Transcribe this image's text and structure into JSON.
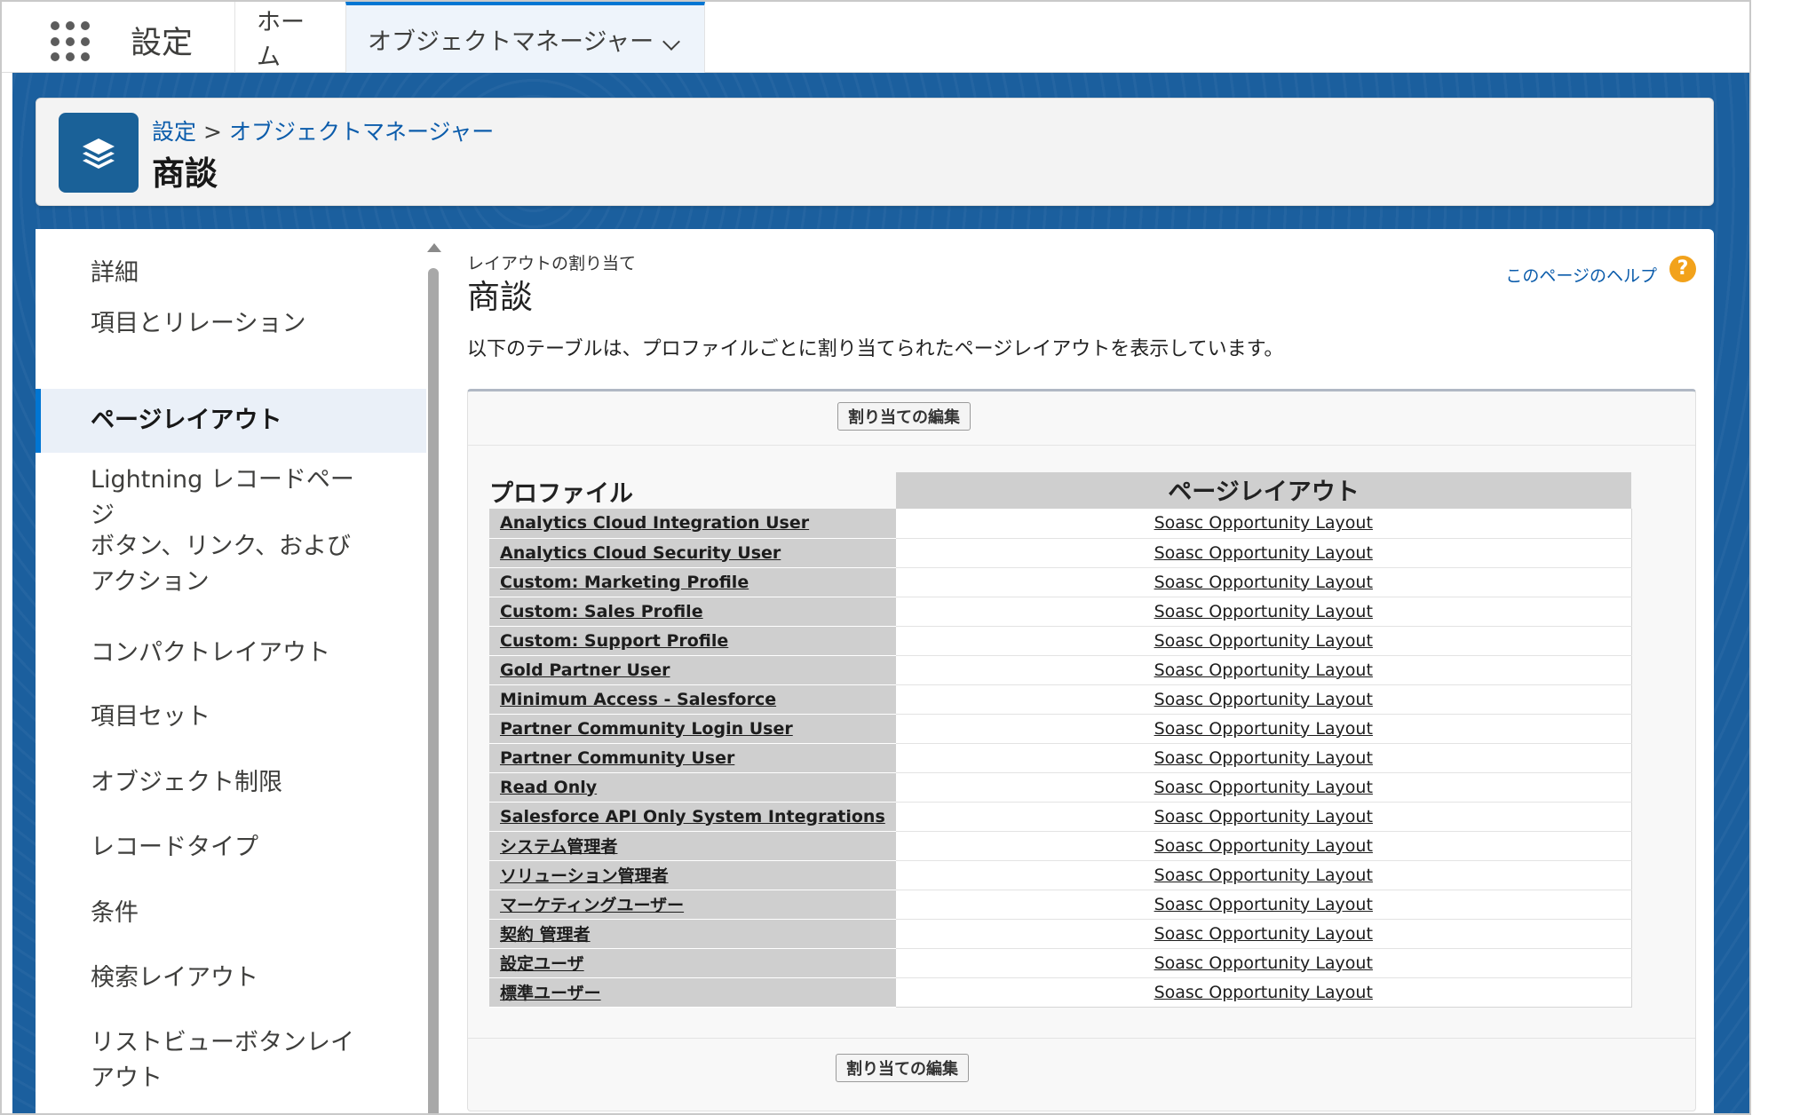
{
  "global_nav": {
    "app_name": "設定",
    "tabs": [
      {
        "label": "ホーム"
      },
      {
        "label": "オブジェクトマネージャー"
      }
    ]
  },
  "header": {
    "breadcrumb": [
      {
        "label": "設定"
      },
      {
        "label": "オブジェクトマネージャー"
      }
    ],
    "breadcrumb_separator": ">",
    "title": "商談",
    "icon": "layers-icon"
  },
  "sidebar": {
    "items": [
      {
        "label": "詳細"
      },
      {
        "label": "項目とリレーション"
      },
      {
        "label": "ページレイアウト",
        "active": true
      },
      {
        "label": "Lightning レコードページ"
      },
      {
        "label": "ボタン、リンク、およびアクション"
      },
      {
        "label": "コンパクトレイアウト"
      },
      {
        "label": "項目セット"
      },
      {
        "label": "オブジェクト制限"
      },
      {
        "label": "レコードタイプ"
      },
      {
        "label": "条件"
      },
      {
        "label": "検索レイアウト"
      },
      {
        "label": "リストビューボタンレイアウト"
      }
    ]
  },
  "main": {
    "subtitle": "レイアウトの割り当て",
    "title": "商談",
    "help_link": "このページのヘルプ",
    "help_icon": "?",
    "description": "以下のテーブルは、プロファイルごとに割り当てられたページレイアウトを表示しています。",
    "edit_button": "割り当ての編集",
    "table": {
      "headers": {
        "profile": "プロファイル",
        "layout": "ページレイアウト"
      },
      "rows": [
        {
          "profile": "Analytics Cloud Integration User",
          "layout": "Soasc Opportunity Layout"
        },
        {
          "profile": "Analytics Cloud Security User",
          "layout": "Soasc Opportunity Layout"
        },
        {
          "profile": "Custom: Marketing Profile",
          "layout": "Soasc Opportunity Layout"
        },
        {
          "profile": "Custom: Sales Profile",
          "layout": "Soasc Opportunity Layout"
        },
        {
          "profile": "Custom: Support Profile",
          "layout": "Soasc Opportunity Layout"
        },
        {
          "profile": "Gold Partner User",
          "layout": "Soasc Opportunity Layout"
        },
        {
          "profile": "Minimum Access - Salesforce",
          "layout": "Soasc Opportunity Layout"
        },
        {
          "profile": "Partner Community Login User",
          "layout": "Soasc Opportunity Layout"
        },
        {
          "profile": "Partner Community User",
          "layout": "Soasc Opportunity Layout"
        },
        {
          "profile": "Read Only",
          "layout": "Soasc Opportunity Layout"
        },
        {
          "profile": "Salesforce API Only System Integrations",
          "layout": "Soasc Opportunity Layout"
        },
        {
          "profile": "システム管理者",
          "layout": "Soasc Opportunity Layout"
        },
        {
          "profile": "ソリューション管理者",
          "layout": "Soasc Opportunity Layout"
        },
        {
          "profile": "マーケティングユーザー",
          "layout": "Soasc Opportunity Layout"
        },
        {
          "profile": "契約 管理者",
          "layout": "Soasc Opportunity Layout"
        },
        {
          "profile": "設定ユーザ",
          "layout": "Soasc Opportunity Layout"
        },
        {
          "profile": "標準ユーザー",
          "layout": "Soasc Opportunity Layout"
        }
      ]
    }
  },
  "colors": {
    "brand_blue": "#1b5f9e",
    "link_blue": "#0b5cab",
    "active_accent": "#0176d3",
    "help_orange": "#f2a21b"
  }
}
